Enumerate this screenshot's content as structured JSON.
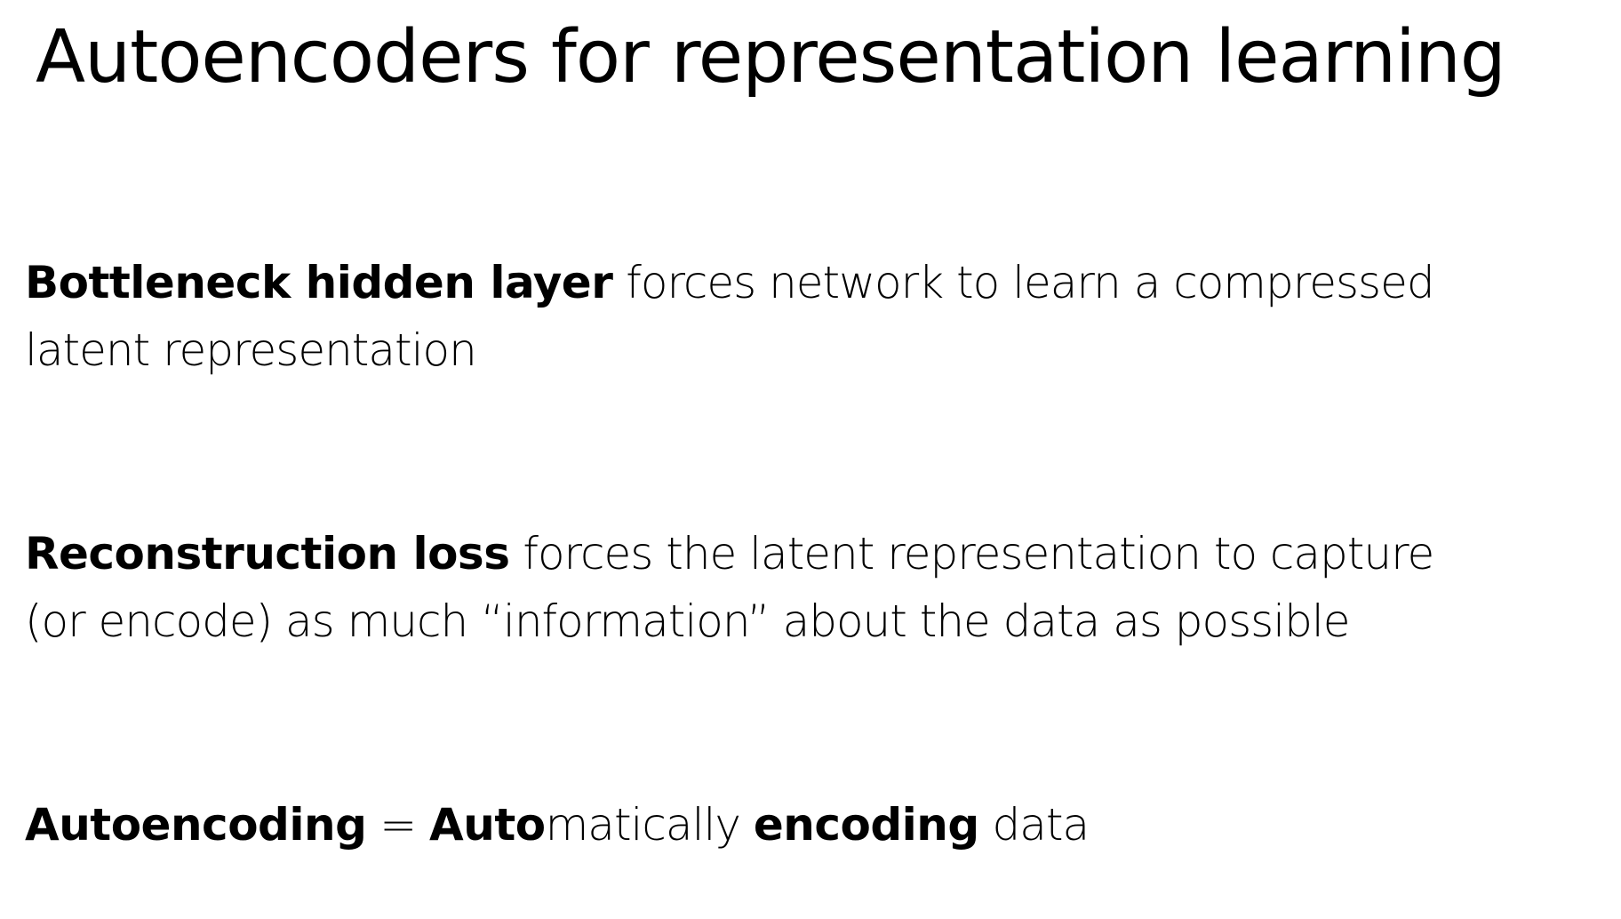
{
  "slide": {
    "title": "Autoencoders for representation learning",
    "bottleneck": {
      "term": "Bottleneck hidden layer",
      "line1_rest": " forces network to learn a compressed",
      "line2": "latent representation"
    },
    "reconstruction": {
      "term": "Reconstruction loss",
      "line1_rest": " forces the latent representation to capture",
      "line2": "(or encode) as much “information” about the data as possible"
    },
    "autoencoding": {
      "term": "Autoencoding",
      "equals": " = ",
      "auto_bold": "Auto",
      "auto_rest": "matically ",
      "encoding_bold": "encoding",
      "data_rest": " data"
    }
  }
}
